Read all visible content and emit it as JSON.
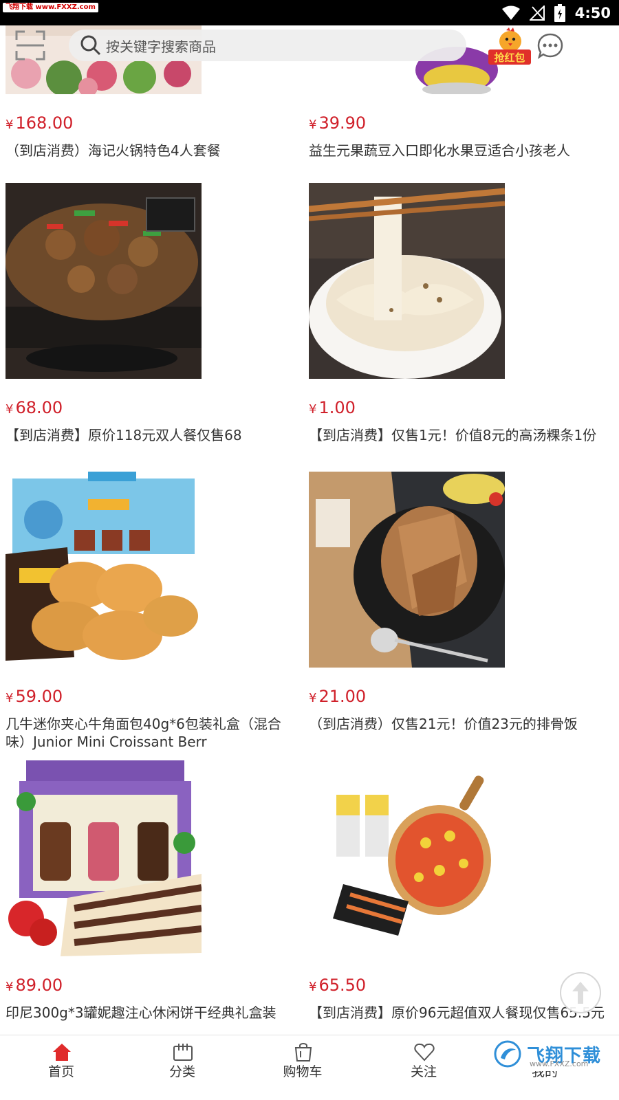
{
  "status_bar": {
    "watermark": "飞翔下载 www.FXXZ.com",
    "time": "4:50"
  },
  "header": {
    "search_placeholder": "按关键字搜索商品",
    "red_packet_label": "抢红包"
  },
  "products": [
    {
      "price": "168.00",
      "currency": "¥",
      "title": "（到店消费）海记火锅特色4人套餐"
    },
    {
      "price": "39.90",
      "currency": "¥",
      "title": "益生元果蔬豆入口即化水果豆适合小孩老人"
    },
    {
      "price": "68.00",
      "currency": "¥",
      "title": "【到店消费】原价118元双人餐仅售68"
    },
    {
      "price": "1.00",
      "currency": "¥",
      "title": "【到店消费】仅售1元！价值8元的高汤粿条1份"
    },
    {
      "price": "59.00",
      "currency": "¥",
      "title": "几牛迷你夹心牛角面包40g*6包装礼盒（混合味）Junior Mini Croissant Berr"
    },
    {
      "price": "21.00",
      "currency": "¥",
      "title": "（到店消费）仅售21元！价值23元的排骨饭"
    },
    {
      "price": "89.00",
      "currency": "¥",
      "title": "印尼300g*3罐妮趣注心休闲饼干经典礼盒装"
    },
    {
      "price": "65.50",
      "currency": "¥",
      "title": "【到店消费】原价96元超值双人餐现仅售65.5元"
    }
  ],
  "bottom_nav": [
    {
      "label": "首页",
      "icon": "home-icon",
      "active": true
    },
    {
      "label": "分类",
      "icon": "category-icon",
      "active": false
    },
    {
      "label": "购物车",
      "icon": "cart-icon",
      "active": false
    },
    {
      "label": "关注",
      "icon": "heart-icon",
      "active": false
    },
    {
      "label": "我的",
      "icon": "user-icon",
      "active": false
    }
  ],
  "bottom_watermark": {
    "brand": "飞翔下载",
    "url": "www.FXXZ.com"
  },
  "colors": {
    "price": "#d0202a",
    "accent": "#e02b2b",
    "text": "#333333"
  }
}
